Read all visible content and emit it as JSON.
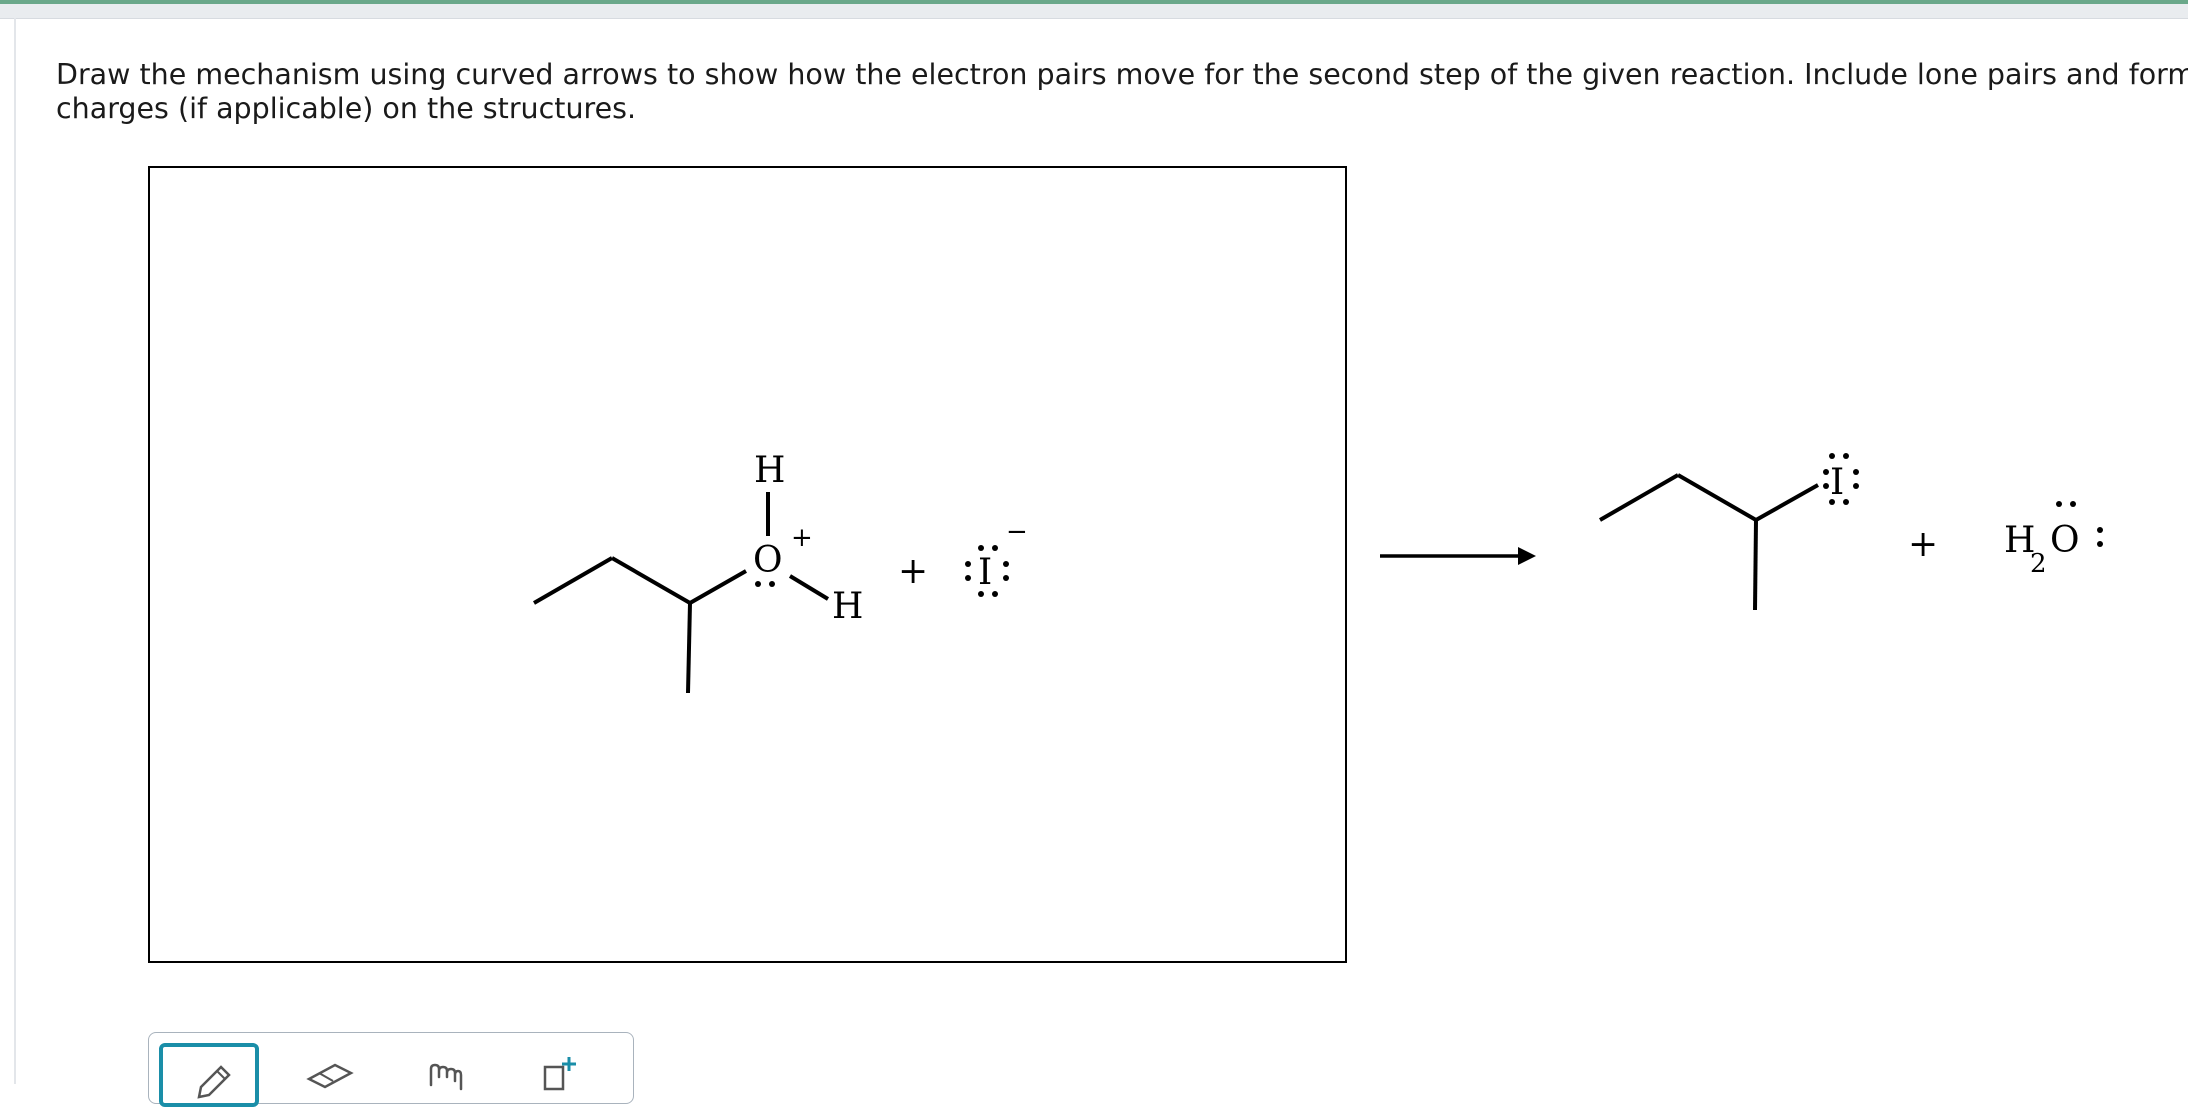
{
  "question": {
    "line1": "Draw the mechanism using curved arrows to show how the electron pairs move for the second step of the given reaction. Include lone pairs and forma",
    "line2": "charges (if applicable) on the structures."
  },
  "reactant": {
    "oxygen": "O",
    "h_top": "H",
    "h_bottom": "H",
    "charge": "+",
    "plus": "+",
    "iodide": "I",
    "iodide_charge": "−"
  },
  "product": {
    "iodine": "I",
    "plus": "+",
    "water_h": "H",
    "water_sub": "2",
    "water_o": "O"
  },
  "toolbar": {
    "tools": [
      "pencil-icon",
      "eraser-icon",
      "hand-icon",
      "add-atom-icon"
    ],
    "active_tool": "pencil-icon",
    "accent_color": "#1a8ea8"
  }
}
